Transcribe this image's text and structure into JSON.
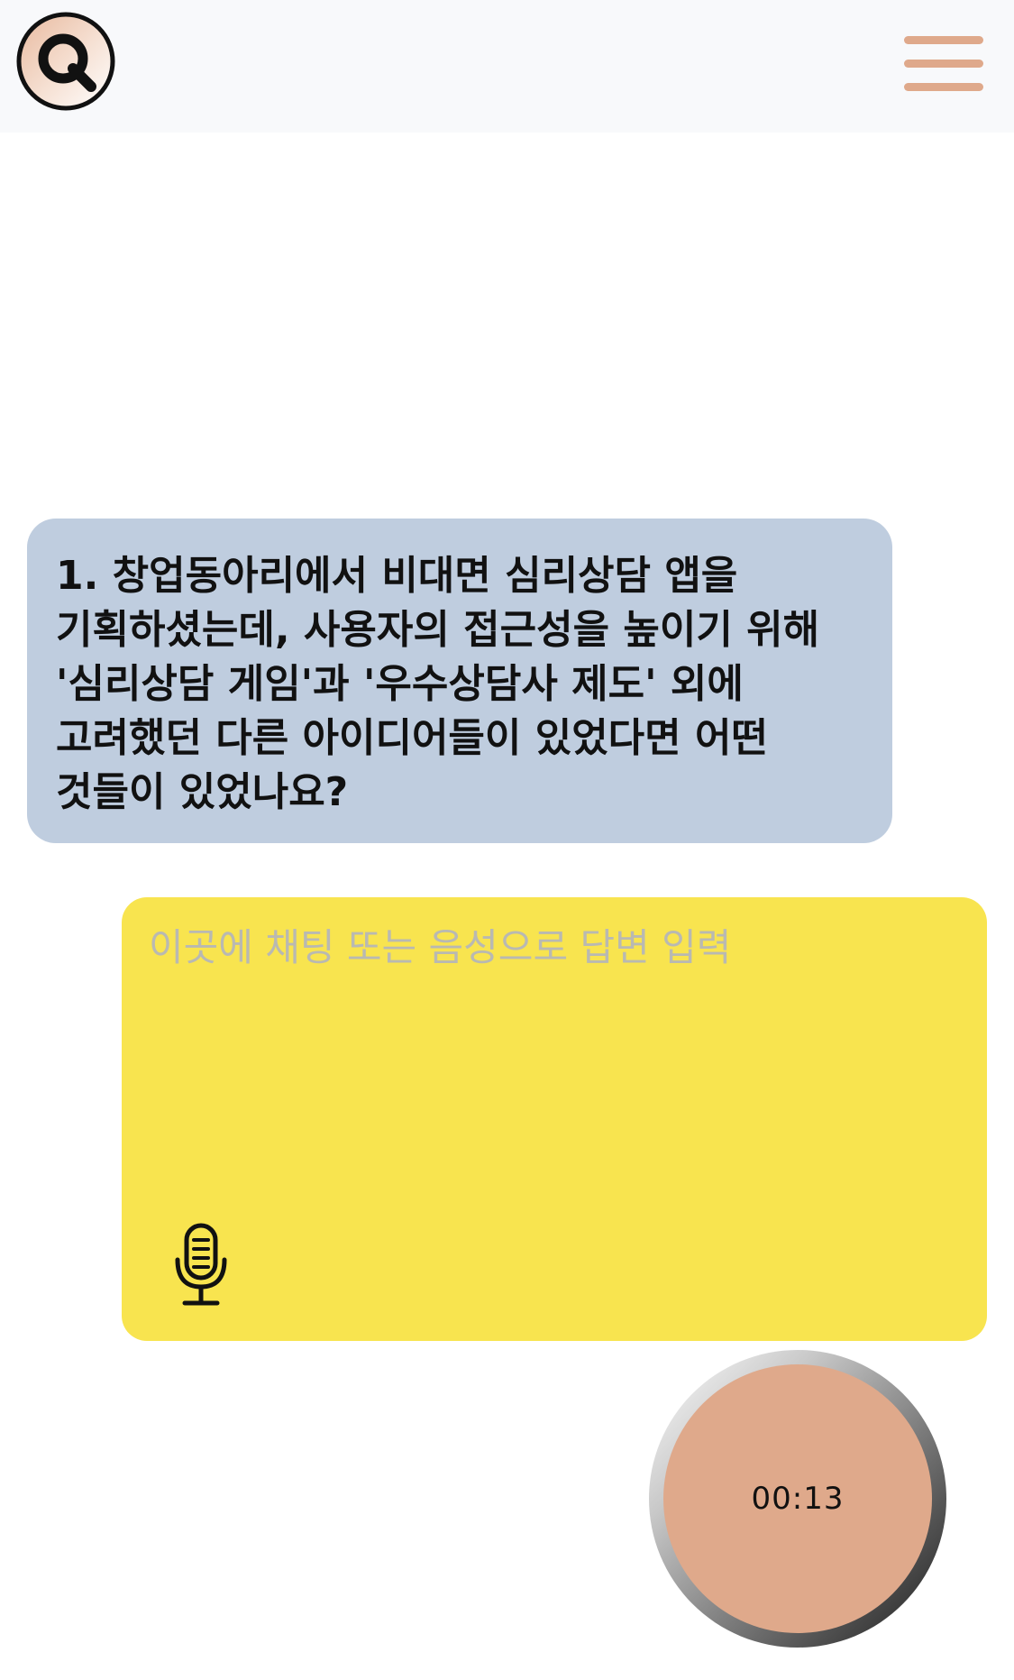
{
  "header": {
    "logo_icon": "q-logo-icon",
    "menu_icon": "hamburger-menu-icon"
  },
  "question": {
    "text": "1. 창업동아리에서 비대면 심리상담 앱을 기획하셨는데, 사용자의 접근성을 높이기 위해 '심리상담 게임'과 '우수상담사 제도' 외에 고려했던 다른 아이디어들이 있었다면 어떤 것들이 있었나요?"
  },
  "answer": {
    "value": "",
    "placeholder": "이곳에 채팅 또는 음성으로 답변 입력",
    "mic_icon": "microphone-icon"
  },
  "timer": {
    "text": "00:13"
  },
  "colors": {
    "header_bg": "#f8f9fb",
    "accent": "#dfa98b",
    "question_bg": "#bfcddf",
    "answer_bg": "#f8e44f",
    "placeholder": "#b9b9b2"
  }
}
